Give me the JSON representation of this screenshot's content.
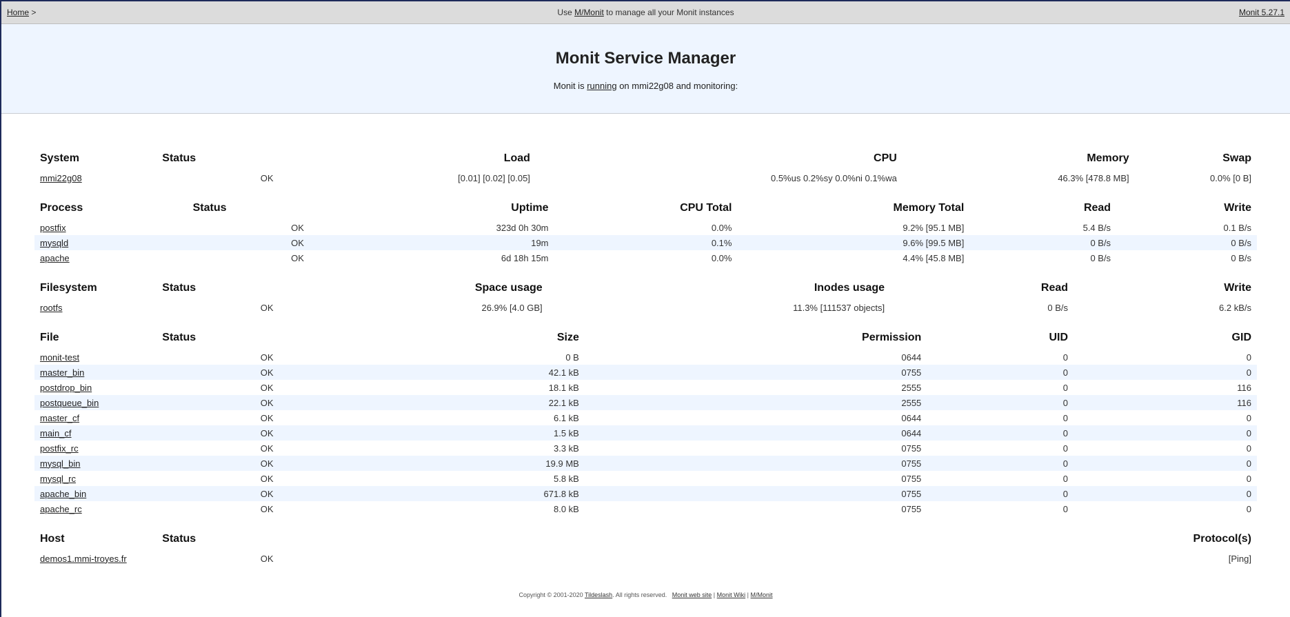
{
  "topbar": {
    "home": "Home",
    "home_sep": ">",
    "center_prefix": "Use",
    "center_link": "M/Monit",
    "center_suffix": "to manage all your Monit instances",
    "version": "Monit 5.27.1"
  },
  "header": {
    "title": "Monit Service Manager",
    "sub_prefix": "Monit is",
    "sub_link": "running",
    "sub_suffix": "on mmi22g08 and monitoring:"
  },
  "system": {
    "headers": [
      "System",
      "Status",
      "Load",
      "CPU",
      "Memory",
      "Swap"
    ],
    "rows": [
      {
        "name": "mmi22g08",
        "status": "OK",
        "load": "[0.01] [0.02] [0.05]",
        "cpu": "0.5%us 0.2%sy 0.0%ni 0.1%wa",
        "memory": "46.3% [478.8 MB]",
        "swap": "0.0% [0 B]"
      }
    ]
  },
  "process": {
    "headers": [
      "Process",
      "Status",
      "Uptime",
      "CPU Total",
      "Memory Total",
      "Read",
      "Write"
    ],
    "rows": [
      {
        "name": "postfix",
        "status": "OK",
        "uptime": "323d 0h 30m",
        "cpu": "0.0%",
        "mem": "9.2% [95.1 MB]",
        "read": "5.4 B/s",
        "write": "0.1 B/s"
      },
      {
        "name": "mysqld",
        "status": "OK",
        "uptime": "19m",
        "cpu": "0.1%",
        "mem": "9.6% [99.5 MB]",
        "read": "0 B/s",
        "write": "0 B/s"
      },
      {
        "name": "apache",
        "status": "OK",
        "uptime": "6d 18h 15m",
        "cpu": "0.0%",
        "mem": "4.4% [45.8 MB]",
        "read": "0 B/s",
        "write": "0 B/s"
      }
    ]
  },
  "filesystem": {
    "headers": [
      "Filesystem",
      "Status",
      "Space usage",
      "Inodes usage",
      "Read",
      "Write"
    ],
    "rows": [
      {
        "name": "rootfs",
        "status": "OK",
        "space": "26.9% [4.0 GB]",
        "inodes": "11.3% [111537 objects]",
        "read": "0 B/s",
        "write": "6.2 kB/s"
      }
    ]
  },
  "file": {
    "headers": [
      "File",
      "Status",
      "Size",
      "Permission",
      "UID",
      "GID"
    ],
    "rows": [
      {
        "name": "monit-test",
        "status": "OK",
        "size": "0 B",
        "perm": "0644",
        "uid": "0",
        "gid": "0"
      },
      {
        "name": "master_bin",
        "status": "OK",
        "size": "42.1 kB",
        "perm": "0755",
        "uid": "0",
        "gid": "0"
      },
      {
        "name": "postdrop_bin",
        "status": "OK",
        "size": "18.1 kB",
        "perm": "2555",
        "uid": "0",
        "gid": "116"
      },
      {
        "name": "postqueue_bin",
        "status": "OK",
        "size": "22.1 kB",
        "perm": "2555",
        "uid": "0",
        "gid": "116"
      },
      {
        "name": "master_cf",
        "status": "OK",
        "size": "6.1 kB",
        "perm": "0644",
        "uid": "0",
        "gid": "0"
      },
      {
        "name": "main_cf",
        "status": "OK",
        "size": "1.5 kB",
        "perm": "0644",
        "uid": "0",
        "gid": "0"
      },
      {
        "name": "postfix_rc",
        "status": "OK",
        "size": "3.3 kB",
        "perm": "0755",
        "uid": "0",
        "gid": "0"
      },
      {
        "name": "mysql_bin",
        "status": "OK",
        "size": "19.9 MB",
        "perm": "0755",
        "uid": "0",
        "gid": "0"
      },
      {
        "name": "mysql_rc",
        "status": "OK",
        "size": "5.8 kB",
        "perm": "0755",
        "uid": "0",
        "gid": "0"
      },
      {
        "name": "apache_bin",
        "status": "OK",
        "size": "671.8 kB",
        "perm": "0755",
        "uid": "0",
        "gid": "0"
      },
      {
        "name": "apache_rc",
        "status": "OK",
        "size": "8.0 kB",
        "perm": "0755",
        "uid": "0",
        "gid": "0"
      }
    ]
  },
  "host": {
    "headers": [
      "Host",
      "Status",
      "Protocol(s)"
    ],
    "rows": [
      {
        "name": "demos1.mmi-troyes.fr",
        "status": "OK",
        "protocol": "[Ping]"
      }
    ]
  },
  "footer": {
    "copyright": "Copyright © 2001-2020",
    "tildeslash": "Tildeslash",
    "rights": ". All rights reserved.",
    "site": "Monit web site",
    "sep1": "|",
    "wiki": "Monit Wiki",
    "sep2": "|",
    "mmonit": "M/Monit"
  },
  "colors": {
    "ok": "#22dd22",
    "row_alt": "#eef5ff",
    "topbar": "#dcdcdc"
  }
}
